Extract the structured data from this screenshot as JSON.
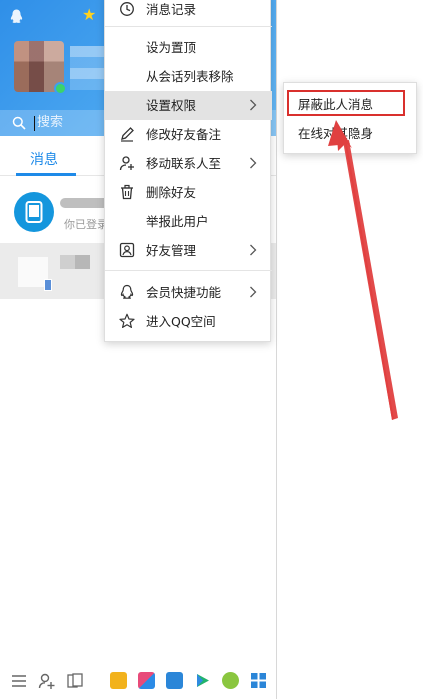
{
  "search": {
    "placeholder": "搜索"
  },
  "tabs": {
    "messages": "消息"
  },
  "conversations": [
    {
      "preview": "你已登录"
    }
  ],
  "context_menu": {
    "items": [
      {
        "label": "消息记录",
        "icon": "clock-icon"
      },
      {
        "label": "设为置顶"
      },
      {
        "label": "从会话列表移除"
      },
      {
        "label": "设置权限",
        "submenu": true,
        "active": true
      },
      {
        "label": "修改好友备注",
        "icon": "pencil-icon"
      },
      {
        "label": "移动联系人至",
        "icon": "person-move-icon",
        "submenu": true
      },
      {
        "label": "删除好友",
        "icon": "trash-icon"
      },
      {
        "label": "举报此用户"
      },
      {
        "label": "好友管理",
        "icon": "contact-card-icon",
        "submenu": true
      },
      {
        "label": "会员快捷功能",
        "icon": "penguin-icon",
        "submenu": true
      },
      {
        "label": "进入QQ空间",
        "icon": "star-outline-icon"
      }
    ]
  },
  "submenu": {
    "items": [
      {
        "label": "屏蔽此人消息",
        "highlighted": true
      },
      {
        "label": "在线对其隐身"
      }
    ]
  },
  "colors": {
    "accent": "#1e8ae8",
    "highlight": "#d9302d",
    "arrow": "#e04040"
  }
}
